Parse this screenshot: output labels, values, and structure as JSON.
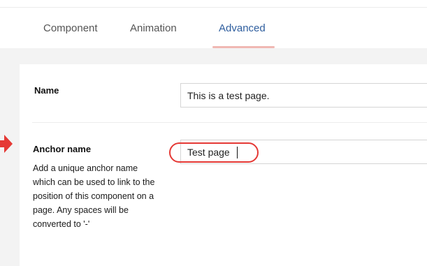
{
  "tabs": [
    {
      "label": "Component",
      "active": false
    },
    {
      "label": "Animation",
      "active": false
    },
    {
      "label": "Advanced",
      "active": true
    }
  ],
  "fields": {
    "name": {
      "label": "Name",
      "value": "This is a test page."
    },
    "anchor": {
      "label": "Anchor name",
      "value": "Test page",
      "help": "Add a unique anchor name which can be used to link to the position of this component on a page. Any spaces will be converted to '-'"
    }
  },
  "annotations": {
    "arrow_color": "#e53935",
    "circle_color": "#e53935"
  },
  "colors": {
    "active_tab": "#2f5e9e",
    "tab_underline": "#f0b8b3"
  }
}
